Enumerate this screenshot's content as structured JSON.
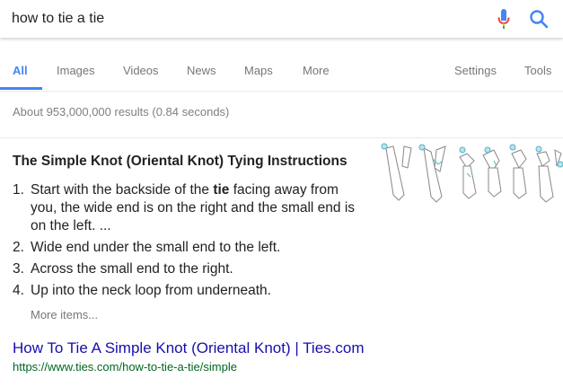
{
  "search": {
    "query": "how to tie a tie"
  },
  "tabs": [
    {
      "label": "All",
      "active": true
    },
    {
      "label": "Images"
    },
    {
      "label": "Videos"
    },
    {
      "label": "News"
    },
    {
      "label": "Maps"
    },
    {
      "label": "More"
    }
  ],
  "tools": {
    "settings_label": "Settings",
    "tools_label": "Tools"
  },
  "stats": "About 953,000,000 results (0.84 seconds)",
  "snippet": {
    "title": "The Simple Knot (Oriental Knot) Tying Instructions",
    "items": [
      {
        "num": "1.",
        "before": "Start with the backside of the ",
        "bold": "tie",
        "after": " facing away from you, the wide end is on the right and the small end is on the left. ..."
      },
      {
        "num": "2.",
        "text": "Wide end under the small end to the left."
      },
      {
        "num": "3.",
        "text": "Across the small end to the right."
      },
      {
        "num": "4.",
        "text": "Up into the neck loop from underneath."
      }
    ],
    "more_items": "More items...",
    "image_icon": "tie-knot-steps-diagram"
  },
  "result": {
    "title": "How To Tie A Simple Knot (Oriental Knot) | Ties.com",
    "url": "https://www.ties.com/how-to-tie-a-tie/simple"
  },
  "colors": {
    "accent": "#4285f4",
    "link": "#1a0dab",
    "url": "#006621",
    "muted": "#777777",
    "text": "#222222"
  }
}
